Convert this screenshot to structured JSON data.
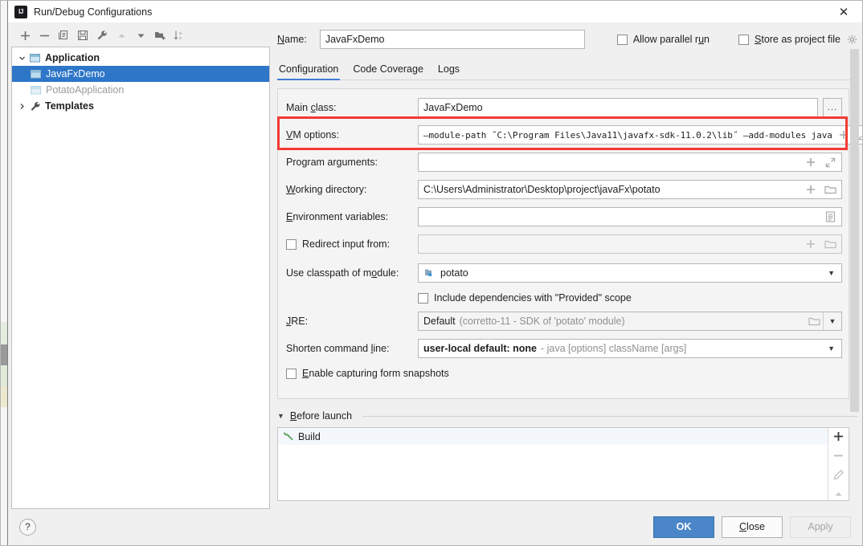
{
  "window": {
    "title": "Run/Debug Configurations",
    "app_icon": "intellij-idea-icon",
    "close_label": "✕"
  },
  "tree_toolbar": {
    "buttons": [
      {
        "name": "add-configuration-button",
        "icon": "plus-icon",
        "enabled": true
      },
      {
        "name": "remove-configuration-button",
        "icon": "minus-icon",
        "enabled": true
      },
      {
        "name": "copy-configuration-button",
        "icon": "copy-icon",
        "enabled": true
      },
      {
        "name": "save-configuration-button",
        "icon": "save-icon",
        "enabled": true
      },
      {
        "name": "edit-templates-button",
        "icon": "wrench-icon",
        "enabled": true
      },
      {
        "name": "move-up-button",
        "icon": "arrow-up-icon",
        "enabled": false
      },
      {
        "name": "move-down-button",
        "icon": "arrow-down-icon",
        "enabled": true
      },
      {
        "name": "create-folder-button",
        "icon": "folder-add-icon",
        "enabled": true
      },
      {
        "name": "sort-configurations-button",
        "icon": "sort-az-icon",
        "enabled": true
      }
    ]
  },
  "tree": {
    "nodes": [
      {
        "label": "Application",
        "icon": "application-icon",
        "expanded": true,
        "depth": 0,
        "bold": true,
        "selected": false,
        "dim": false
      },
      {
        "label": "JavaFxDemo",
        "icon": "run-config-icon",
        "depth": 1,
        "bold": false,
        "selected": true,
        "dim": false
      },
      {
        "label": "PotatoApplication",
        "icon": "run-config-icon",
        "depth": 1,
        "bold": false,
        "selected": false,
        "dim": true
      },
      {
        "label": "Templates",
        "icon": "wrench-icon",
        "expanded": false,
        "depth": 0,
        "bold": true,
        "selected": false,
        "dim": false
      }
    ]
  },
  "header": {
    "name_label": "Name:",
    "name_value": "JavaFxDemo",
    "allow_parallel_run_label": "Allow parallel run",
    "allow_parallel_run_checked": false,
    "store_as_project_file_label": "Store as project file",
    "store_as_project_file_checked": false,
    "gear_icon": "gear-icon"
  },
  "tabs": [
    {
      "label": "Configuration",
      "active": true
    },
    {
      "label": "Code Coverage",
      "active": false
    },
    {
      "label": "Logs",
      "active": false
    }
  ],
  "form": {
    "main_class": {
      "label": "Main class:",
      "value": "JavaFxDemo",
      "browse_label": "..."
    },
    "vm_options": {
      "label": "VM options:",
      "value": "—module-path ˝C:\\Program Files\\Java11\\javafx-sdk-11.0.2\\lib˝ —add-modules javа",
      "highlighted": true,
      "add_icon": "plus-icon",
      "expand_icon": "expand-icon"
    },
    "program_arguments": {
      "label": "Program arguments:",
      "value": "",
      "add_icon": "plus-icon",
      "expand_icon": "expand-icon"
    },
    "working_directory": {
      "label": "Working directory:",
      "value": "C:\\Users\\Administrator\\Desktop\\project\\javaFx\\potato",
      "add_icon": "plus-icon",
      "browse_icon": "folder-icon"
    },
    "environment_variables": {
      "label": "Environment variables:",
      "value": "",
      "browse_icon": "list-icon"
    },
    "redirect_input": {
      "label": "Redirect input from:",
      "checked": false,
      "value": "",
      "add_icon": "plus-icon",
      "browse_icon": "folder-icon"
    },
    "use_classpath_of_module": {
      "label": "Use classpath of module:",
      "value": "potato",
      "icon": "module-icon"
    },
    "include_provided_scope": {
      "label": "Include dependencies with \"Provided\" scope",
      "checked": false
    },
    "jre": {
      "label": "JRE:",
      "value": "Default",
      "hint": "(corretto-11 - SDK of 'potato' module)",
      "browse_icon": "folder-icon"
    },
    "shorten_command_line": {
      "label": "Shorten command line:",
      "value": "user-local default: none",
      "hint": "- java [options] className [args]"
    },
    "enable_form_snapshots": {
      "label": "Enable capturing form snapshots",
      "checked": false
    }
  },
  "before_launch": {
    "title": "Before launch",
    "expanded": true,
    "items": [
      {
        "label": "Build",
        "icon": "build-hammer-icon"
      }
    ],
    "side_buttons": [
      {
        "name": "add-task-button",
        "icon": "plus-icon",
        "enabled": true
      },
      {
        "name": "remove-task-button",
        "icon": "minus-icon",
        "enabled": false
      },
      {
        "name": "edit-task-button",
        "icon": "pencil-icon",
        "enabled": false
      },
      {
        "name": "move-task-up-button",
        "icon": "arrow-up-icon",
        "enabled": false
      }
    ]
  },
  "footer": {
    "help_label": "?",
    "ok_label": "OK",
    "close_label": "Close",
    "apply_label": "Apply",
    "apply_enabled": false
  },
  "colors": {
    "accent": "#4a86c8",
    "selection": "#2d76c8",
    "annotation": "#f23a33",
    "tab_underline": "#3e7dd4"
  }
}
